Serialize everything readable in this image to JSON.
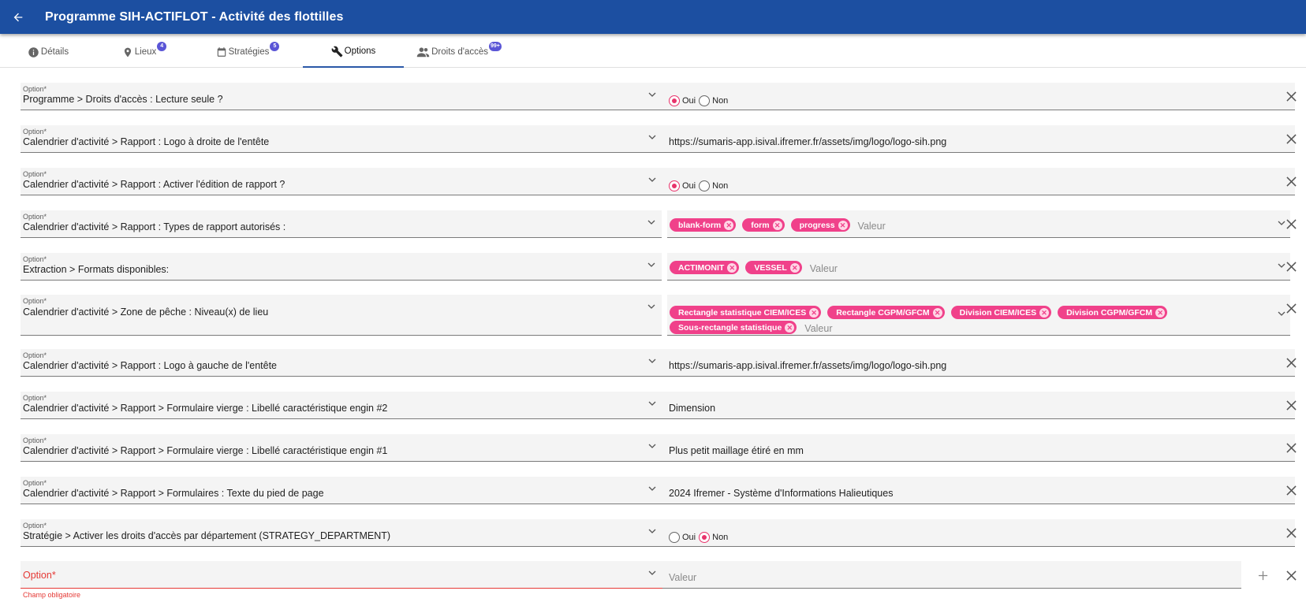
{
  "header": {
    "title": "Programme SIH-ACTIFLOT - Activité des flottilles",
    "bg_color": "#1c4fa1"
  },
  "tabs": [
    {
      "label": "Détails",
      "badge": "",
      "icon": "info-icon"
    },
    {
      "label": "Lieux",
      "badge": "4",
      "icon": "location-icon"
    },
    {
      "label": "Stratégies",
      "badge": "5",
      "icon": "calendar-icon"
    },
    {
      "label": "Options",
      "badge": "",
      "icon": "wrench-icon",
      "active": true
    },
    {
      "label": "Droits d'accès",
      "badge": "99+",
      "icon": "people-icon"
    }
  ],
  "option_label": "Option*",
  "value_placeholder": "Valeur",
  "radio_labels": {
    "yes": "Oui",
    "no": "Non"
  },
  "accent_color": "#f0418a",
  "rows": [
    {
      "option": "Programme > Droits d'accès : Lecture seule ?",
      "type": "radio",
      "selected": "yes"
    },
    {
      "option": "Calendrier d'activité > Rapport : Logo à droite de l'entête",
      "type": "text",
      "value": "https://sumaris-app.isival.ifremer.fr/assets/img/logo/logo-sih.png"
    },
    {
      "option": "Calendrier d'activité > Rapport : Activer l'édition de rapport ?",
      "type": "radio",
      "selected": "yes"
    },
    {
      "option": "Calendrier d'activité  > Rapport : Types de rapport autorisés :",
      "type": "chips",
      "chips": [
        "blank-form",
        "form",
        "progress"
      ]
    },
    {
      "option": "Extraction > Formats disponibles:",
      "type": "chips",
      "chips": [
        "ACTIMONIT",
        "VESSEL"
      ]
    },
    {
      "option": "Calendrier d'activité > Zone de pêche : Niveau(x) de lieu",
      "type": "chips",
      "chips": [
        "Rectangle statistique CIEM/ICES",
        "Rectangle CGPM/GFCM",
        "Division CIEM/ICES",
        "Division CGPM/GFCM",
        "Sous-rectangle statistique"
      ]
    },
    {
      "option": "Calendrier d'activité > Rapport : Logo à gauche de l'entête",
      "type": "text",
      "value": "https://sumaris-app.isival.ifremer.fr/assets/img/logo/logo-sih.png"
    },
    {
      "option": "Calendrier d'activité > Rapport > Formulaire vierge : Libellé caractéristique engin #2",
      "type": "text",
      "value": "Dimension"
    },
    {
      "option": "Calendrier d'activité > Rapport > Formulaire vierge : Libellé caractéristique engin #1",
      "type": "text",
      "value": "Plus petit maillage étiré en mm"
    },
    {
      "option": "Calendrier d'activité > Rapport > Formulaires : Texte du pied de page",
      "type": "text",
      "value": "2024 Ifremer - Système d'Informations Halieutiques"
    },
    {
      "option": "Stratégie > Activer les droits d'accès par département (STRATEGY_DEPARTMENT)",
      "type": "radio",
      "selected": "no"
    }
  ],
  "new_row": {
    "option_label": "Option*",
    "value_placeholder": "Valeur",
    "error": "Champ obligatoire"
  }
}
